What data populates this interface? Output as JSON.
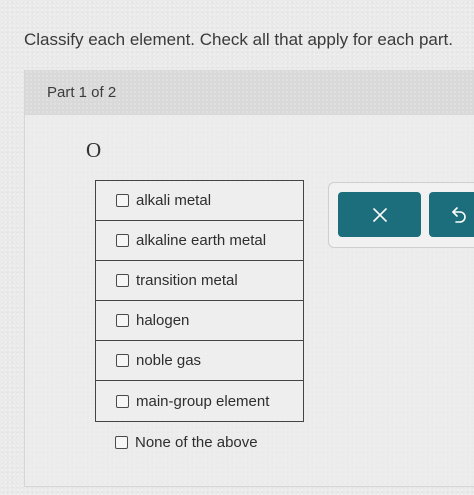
{
  "instruction": "Classify each element. Check all that apply for each part.",
  "part": {
    "label": "Part 1 of 2"
  },
  "element_symbol": "O",
  "options": [
    {
      "label": "alkali metal",
      "checked": false
    },
    {
      "label": "alkaline earth metal",
      "checked": false
    },
    {
      "label": "transition metal",
      "checked": false
    },
    {
      "label": "halogen",
      "checked": false
    },
    {
      "label": "noble gas",
      "checked": false
    },
    {
      "label": "main-group element",
      "checked": false
    }
  ],
  "none_option": {
    "label": "None of the above",
    "checked": false
  },
  "actions": {
    "clear_icon": "close-icon",
    "undo_icon": "undo-icon",
    "button_color": "#1d6e7c"
  }
}
